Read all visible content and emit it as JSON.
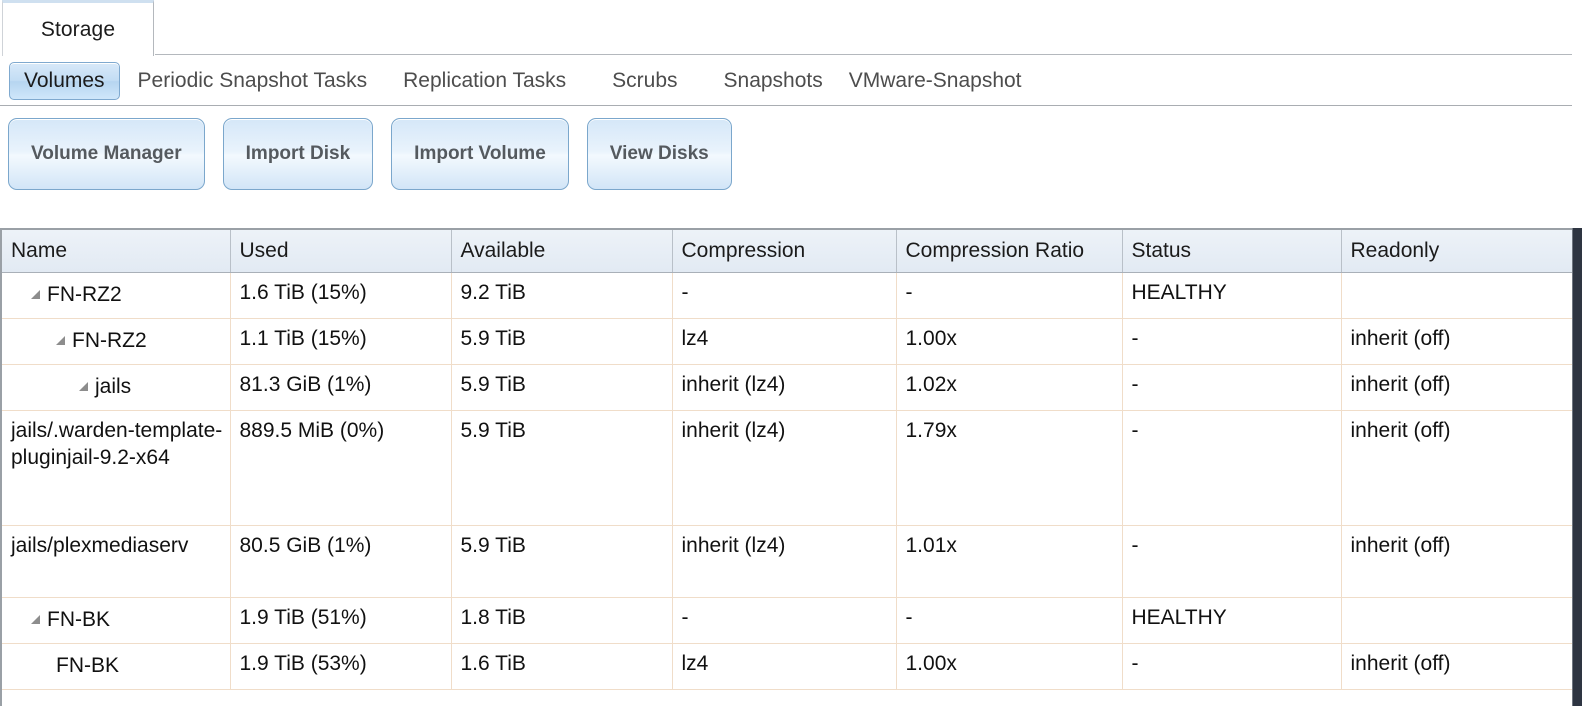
{
  "window": {
    "tab_label": "Storage"
  },
  "section_tabs": [
    {
      "label": "Volumes",
      "active": true
    },
    {
      "label": "Periodic Snapshot Tasks",
      "active": false
    },
    {
      "label": "Replication Tasks",
      "active": false
    },
    {
      "label": "Scrubs",
      "active": false
    },
    {
      "label": "Snapshots",
      "active": false
    },
    {
      "label": "VMware-Snapshot",
      "active": false
    }
  ],
  "toolbar": {
    "buttons": [
      {
        "label": "Volume Manager"
      },
      {
        "label": "Import Disk"
      },
      {
        "label": "Import Volume"
      },
      {
        "label": "View Disks"
      }
    ]
  },
  "grid": {
    "columns": [
      "Name",
      "Used",
      "Available",
      "Compression",
      "Compression Ratio",
      "Status",
      "Readonly"
    ],
    "rows": [
      {
        "name": "FN-RZ2",
        "indent": 0,
        "expander": true,
        "used": "1.6 TiB (15%)",
        "available": "9.2 TiB",
        "compression": "-",
        "compression_ratio": "-",
        "status": "HEALTHY",
        "readonly": ""
      },
      {
        "name": "FN-RZ2",
        "indent": 1,
        "expander": true,
        "used": "1.1 TiB (15%)",
        "available": "5.9 TiB",
        "compression": "lz4",
        "compression_ratio": "1.00x",
        "status": "-",
        "readonly": "inherit (off)"
      },
      {
        "name": "jails",
        "indent": 2,
        "expander": true,
        "used": "81.3 GiB (1%)",
        "available": "5.9 TiB",
        "compression": "inherit (lz4)",
        "compression_ratio": "1.02x",
        "status": "-",
        "readonly": "inherit (off)"
      },
      {
        "name": "jails/.warden-template-pluginjail-9.2-x64",
        "indent": 0,
        "expander": false,
        "used": "889.5 MiB (0%)",
        "available": "5.9 TiB",
        "compression": "inherit (lz4)",
        "compression_ratio": "1.79x",
        "status": "-",
        "readonly": "inherit (off)"
      },
      {
        "name": "jails/plexmediaserv",
        "indent": 0,
        "expander": false,
        "used": "80.5 GiB (1%)",
        "available": "5.9 TiB",
        "compression": "inherit (lz4)",
        "compression_ratio": "1.01x",
        "status": "-",
        "readonly": "inherit (off)"
      },
      {
        "name": "FN-BK",
        "indent": 0,
        "expander": true,
        "used": "1.9 TiB (51%)",
        "available": "1.8 TiB",
        "compression": "-",
        "compression_ratio": "-",
        "status": "HEALTHY",
        "readonly": ""
      },
      {
        "name": "FN-BK",
        "indent": 1,
        "expander": false,
        "used": "1.9 TiB (53%)",
        "available": "1.6 TiB",
        "compression": "lz4",
        "compression_ratio": "1.00x",
        "status": "-",
        "readonly": "inherit (off)"
      }
    ]
  },
  "colors": {
    "accent_blue": "#b6d5f0",
    "button_border": "#7ba7cc",
    "row_divider": "#f0ddc9",
    "header_bg": "#e2eaf3"
  }
}
